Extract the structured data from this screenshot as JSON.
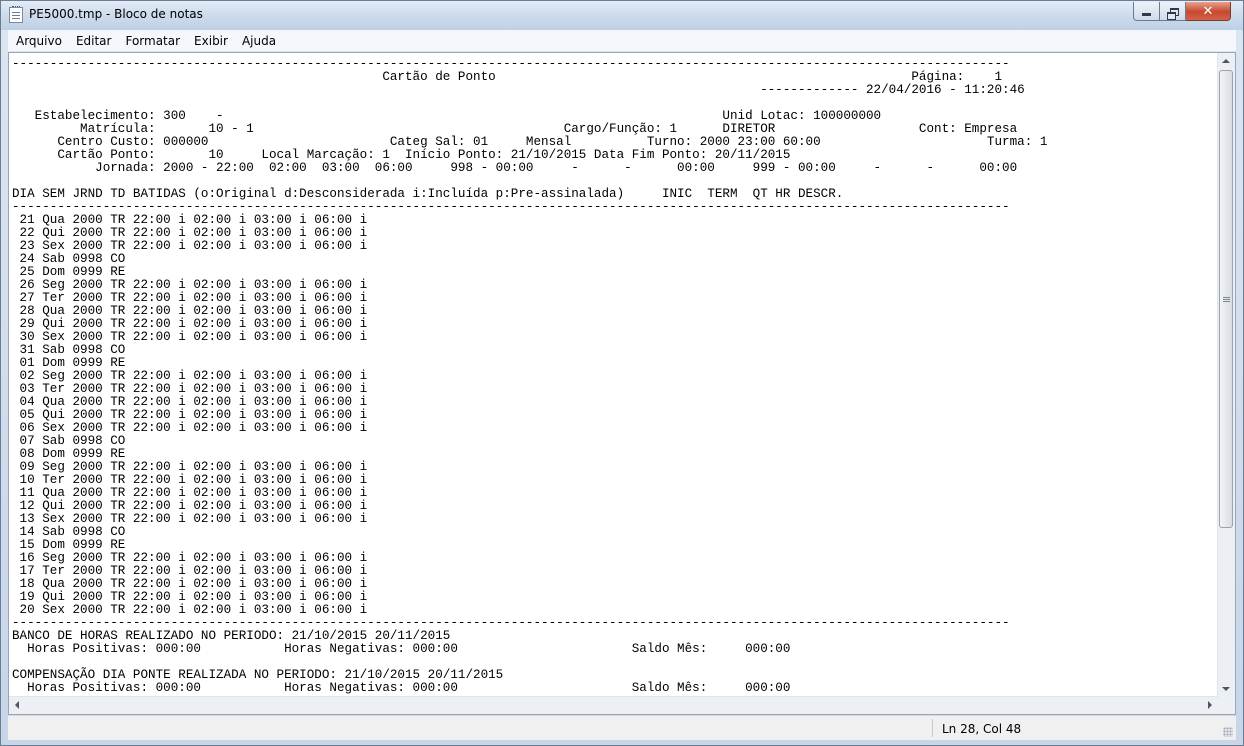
{
  "window": {
    "title": "PE5000.tmp - Bloco de notas",
    "controls": {
      "minimize": "",
      "maximize": "",
      "close": "✕"
    }
  },
  "menu": [
    "Arquivo",
    "Editar",
    "Formatar",
    "Exibir",
    "Ajuda"
  ],
  "document": {
    "lines": [
      "------------------------------------------------------------------------------------------------------------------------------------",
      "                                                 Cartão de Ponto                                                       Página:    1",
      "                                                                                                   ------------- 22/04/2016 - 11:20:46",
      "",
      "   Estabelecimento: 300    -                                                                  Unid Lotac: 100000000",
      "         Matrícula:       10 - 1                                         Cargo/Função: 1      DIRETOR                   Cont: Empresa",
      "      Centro Custo: 000000                        Categ Sal: 01     Mensal          Turno: 2000 23:00 60:00                      Turma: 1",
      "      Cartão Ponto:       10     Local Marcação: 1  Início Ponto: 21/10/2015 Data Fim Ponto: 20/11/2015",
      "           Jornada: 2000 - 22:00  02:00  03:00  06:00     998 - 00:00     -      -      00:00     999 - 00:00     -      -      00:00",
      "",
      "DIA SEM JRND TD BATIDAS (o:Original d:Desconsiderada i:Incluída p:Pre-assinalada)     INIC  TERM  QT HR DESCR.",
      "------------------------------------------------------------------------------------------------------------------------------------",
      " 21 Qua 2000 TR 22:00 i 02:00 i 03:00 i 06:00 i",
      " 22 Qui 2000 TR 22:00 i 02:00 i 03:00 i 06:00 i",
      " 23 Sex 2000 TR 22:00 i 02:00 i 03:00 i 06:00 i",
      " 24 Sab 0998 CO",
      " 25 Dom 0999 RE",
      " 26 Seg 2000 TR 22:00 i 02:00 i 03:00 i 06:00 i",
      " 27 Ter 2000 TR 22:00 i 02:00 i 03:00 i 06:00 i",
      " 28 Qua 2000 TR 22:00 i 02:00 i 03:00 i 06:00 i",
      " 29 Qui 2000 TR 22:00 i 02:00 i 03:00 i 06:00 i",
      " 30 Sex 2000 TR 22:00 i 02:00 i 03:00 i 06:00 i",
      " 31 Sab 0998 CO",
      " 01 Dom 0999 RE",
      " 02 Seg 2000 TR 22:00 i 02:00 i 03:00 i 06:00 i",
      " 03 Ter 2000 TR 22:00 i 02:00 i 03:00 i 06:00 i",
      " 04 Qua 2000 TR 22:00 i 02:00 i 03:00 i 06:00 i",
      " 05 Qui 2000 TR 22:00 i 02:00 i 03:00 i 06:00 i",
      " 06 Sex 2000 TR 22:00 i 02:00 i 03:00 i 06:00 i",
      " 07 Sab 0998 CO",
      " 08 Dom 0999 RE",
      " 09 Seg 2000 TR 22:00 i 02:00 i 03:00 i 06:00 i",
      " 10 Ter 2000 TR 22:00 i 02:00 i 03:00 i 06:00 i",
      " 11 Qua 2000 TR 22:00 i 02:00 i 03:00 i 06:00 i",
      " 12 Qui 2000 TR 22:00 i 02:00 i 03:00 i 06:00 i",
      " 13 Sex 2000 TR 22:00 i 02:00 i 03:00 i 06:00 i",
      " 14 Sab 0998 CO",
      " 15 Dom 0999 RE",
      " 16 Seg 2000 TR 22:00 i 02:00 i 03:00 i 06:00 i",
      " 17 Ter 2000 TR 22:00 i 02:00 i 03:00 i 06:00 i",
      " 18 Qua 2000 TR 22:00 i 02:00 i 03:00 i 06:00 i",
      " 19 Qui 2000 TR 22:00 i 02:00 i 03:00 i 06:00 i",
      " 20 Sex 2000 TR 22:00 i 02:00 i 03:00 i 06:00 i",
      "------------------------------------------------------------------------------------------------------------------------------------",
      "BANCO DE HORAS REALIZADO NO PERIODO: 21/10/2015 20/11/2015",
      "  Horas Positivas: 000:00           Horas Negativas: 000:00                       Saldo Mês:     000:00",
      "",
      "COMPENSAÇÃO DIA PONTE REALIZADA NO PERIODO: 21/10/2015 20/11/2015",
      "  Horas Positivas: 000:00           Horas Negativas: 000:00                       Saldo Mês:     000:00"
    ]
  },
  "status": {
    "cursor": "Ln 28, Col 48"
  }
}
